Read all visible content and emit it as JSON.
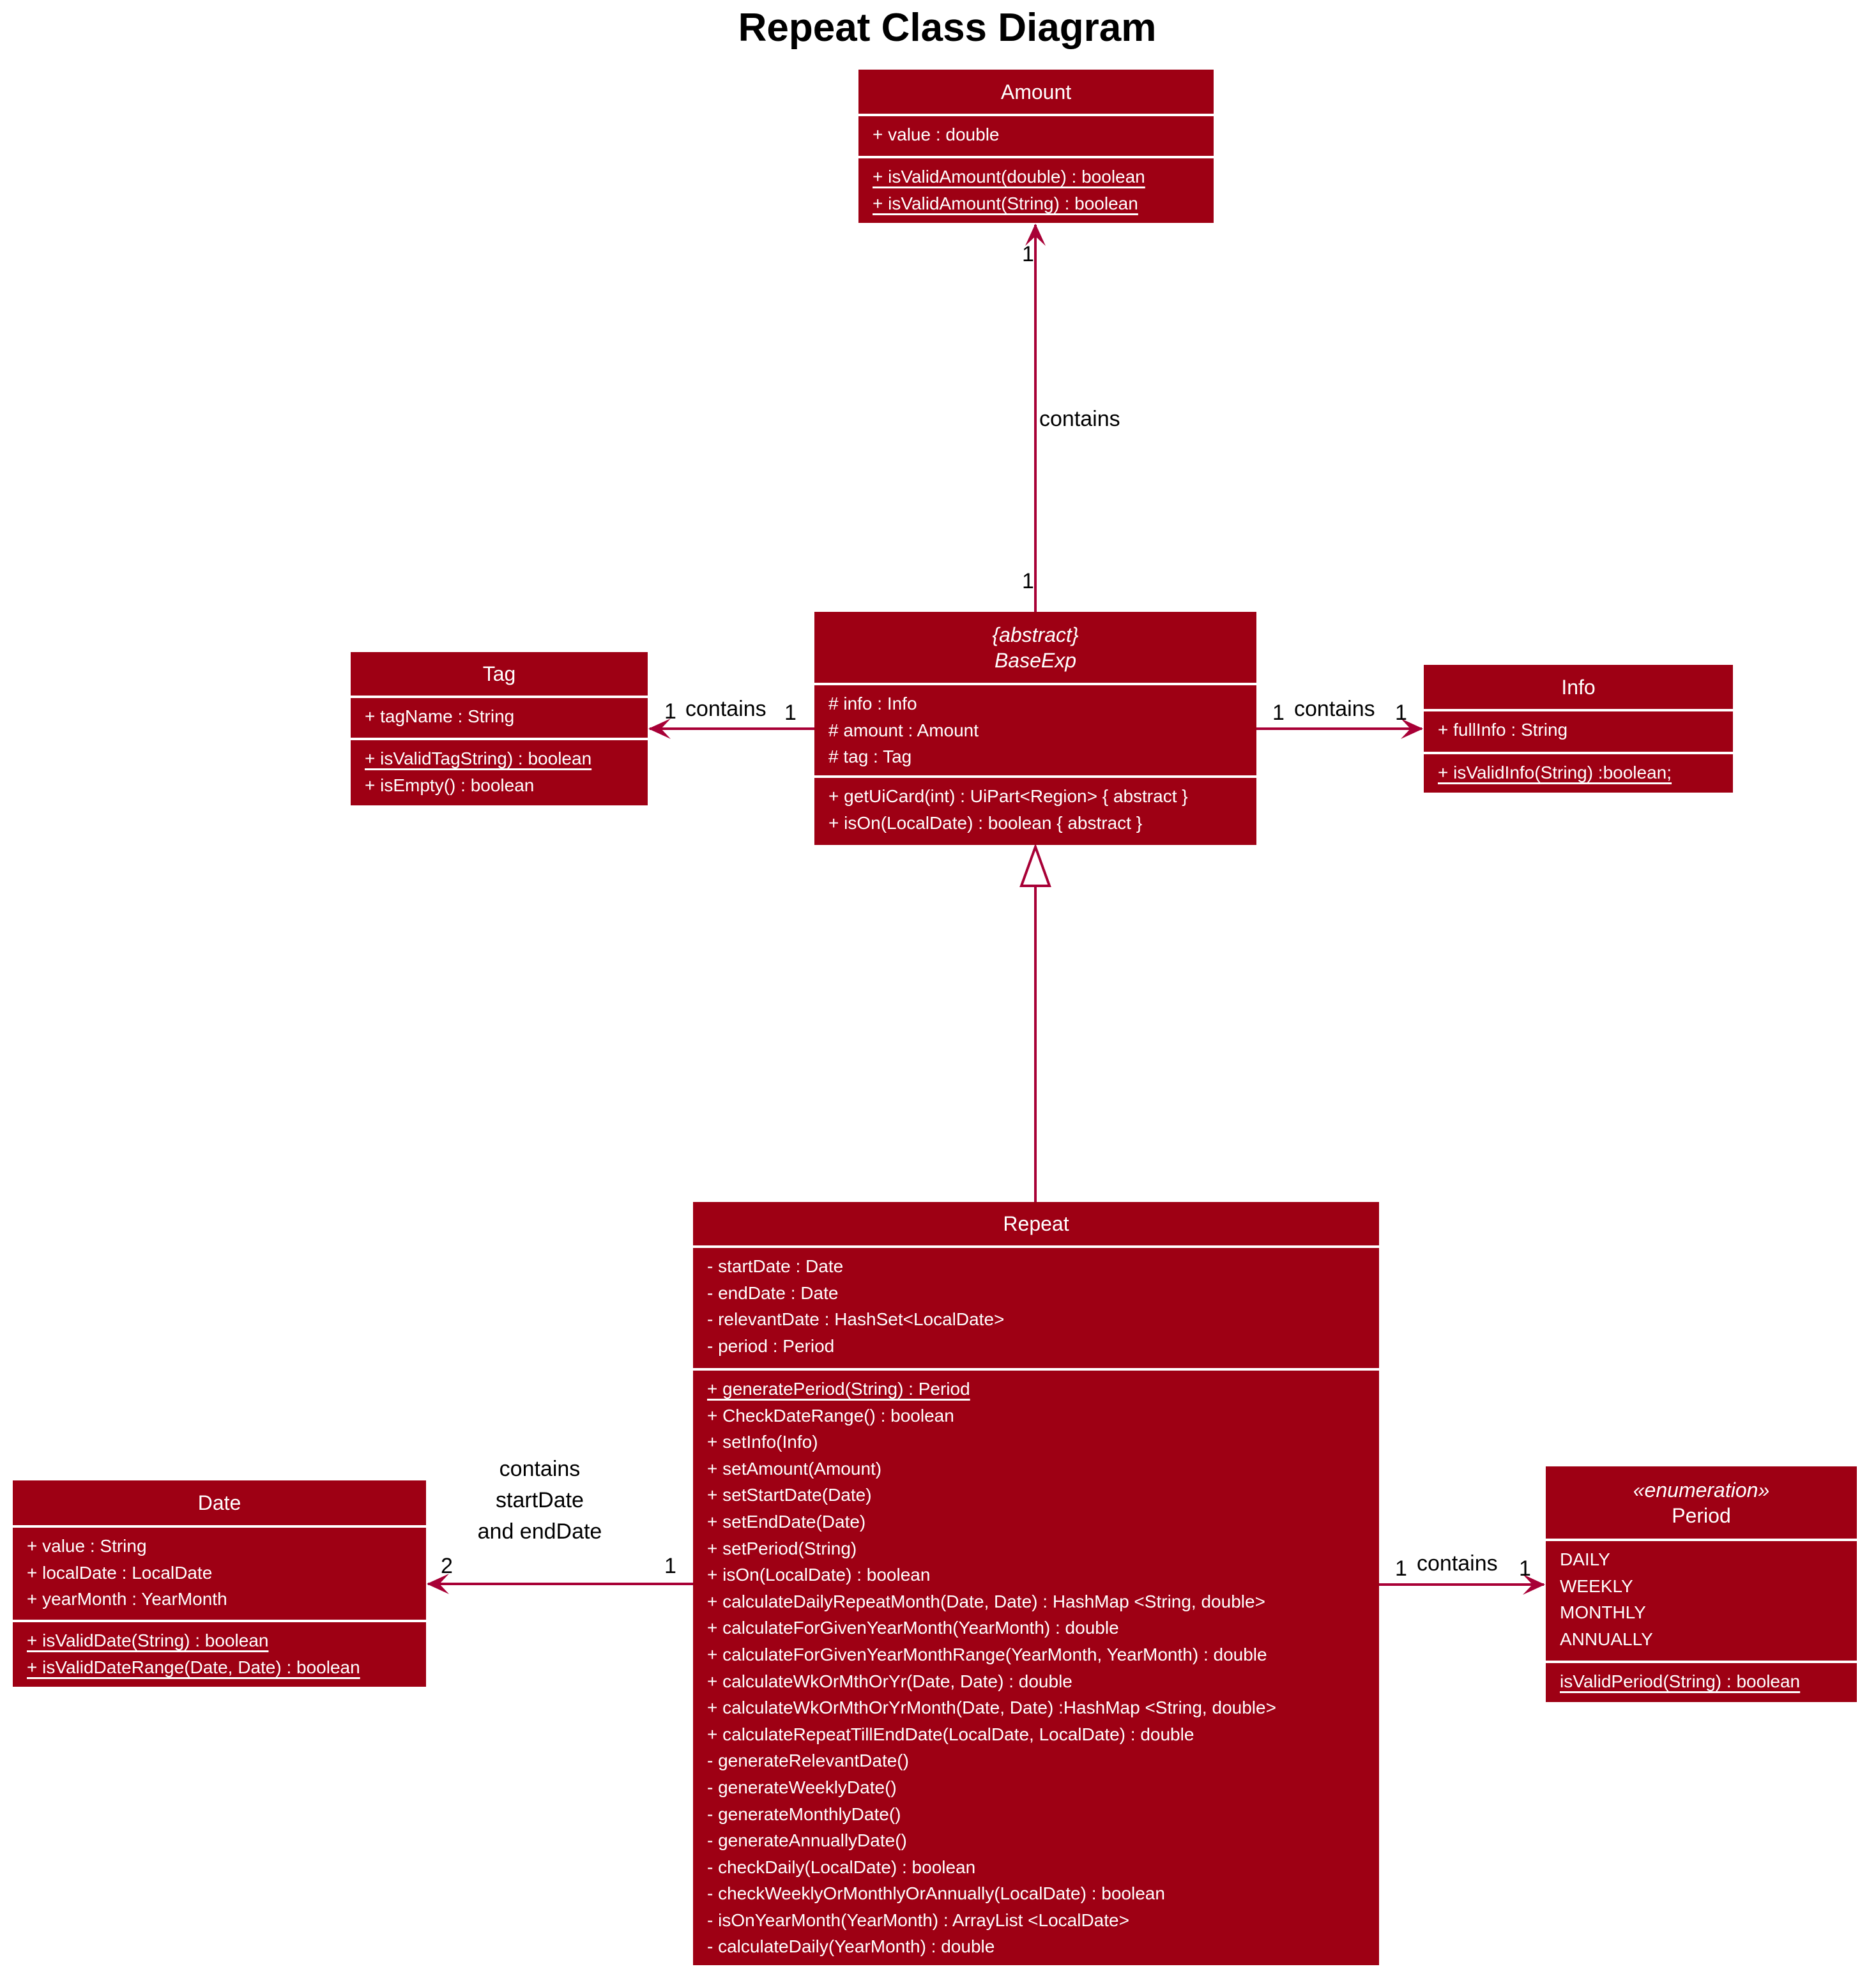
{
  "title": "Repeat Class Diagram",
  "colors": {
    "class_fill": "#9e0014",
    "line": "#a80036",
    "text_on_class": "#ffffff"
  },
  "classes": {
    "amount": {
      "name": "Amount",
      "attributes": [
        "+ value : double"
      ],
      "methods": [
        {
          "text": "+ isValidAmount(double) : boolean",
          "static": true
        },
        {
          "text": "+ isValidAmount(String) : boolean",
          "static": true
        }
      ]
    },
    "baseexp": {
      "stereotype": "{abstract}",
      "name": "BaseExp",
      "attributes": [
        "# info : Info",
        "# amount : Amount",
        "# tag : Tag"
      ],
      "methods": [
        {
          "text": "+ getUiCard(int) : UiPart<Region> { abstract }",
          "static": false
        },
        {
          "text": "+ isOn(LocalDate) : boolean { abstract }",
          "static": false
        }
      ]
    },
    "tag": {
      "name": "Tag",
      "attributes": [
        "+ tagName : String"
      ],
      "methods": [
        {
          "text": "+ isValidTagString) : boolean",
          "static": true
        },
        {
          "text": "+ isEmpty() : boolean",
          "static": false
        }
      ]
    },
    "info": {
      "name": "Info",
      "attributes": [
        "+ fullInfo : String"
      ],
      "methods": [
        {
          "text": " + isValidInfo(String) :boolean;",
          "static": true
        }
      ]
    },
    "repeat": {
      "name": "Repeat",
      "attributes": [
        "- startDate : Date",
        "- endDate : Date",
        "- relevantDate : HashSet<LocalDate>",
        "- period : Period"
      ],
      "methods": [
        {
          "text": "+ generatePeriod(String) : Period",
          "static": true
        },
        {
          "text": "+ CheckDateRange() : boolean",
          "static": false
        },
        {
          "text": "+ setInfo(Info)",
          "static": false
        },
        {
          "text": "+ setAmount(Amount)",
          "static": false
        },
        {
          "text": "+ setStartDate(Date)",
          "static": false
        },
        {
          "text": "+ setEndDate(Date)",
          "static": false
        },
        {
          "text": "+ setPeriod(String)",
          "static": false
        },
        {
          "text": "+ isOn(LocalDate) : boolean",
          "static": false
        },
        {
          "text": "+ calculateDailyRepeatMonth(Date, Date) : HashMap <String, double>",
          "static": false
        },
        {
          "text": "+ calculateForGivenYearMonth(YearMonth) : double",
          "static": false
        },
        {
          "text": "+ calculateForGivenYearMonthRange(YearMonth, YearMonth) : double",
          "static": false
        },
        {
          "text": "+ calculateWkOrMthOrYr(Date, Date) : double",
          "static": false
        },
        {
          "text": "+ calculateWkOrMthOrYrMonth(Date, Date) :HashMap <String, double>",
          "static": false
        },
        {
          "text": "+ calculateRepeatTillEndDate(LocalDate, LocalDate) : double",
          "static": false
        },
        {
          "text": "- generateRelevantDate()",
          "static": false
        },
        {
          "text": "- generateWeeklyDate()",
          "static": false
        },
        {
          "text": "- generateMonthlyDate()",
          "static": false
        },
        {
          "text": "- generateAnnuallyDate()",
          "static": false
        },
        {
          "text": "- checkDaily(LocalDate) : boolean",
          "static": false
        },
        {
          "text": "- checkWeeklyOrMonthlyOrAnnually(LocalDate) : boolean",
          "static": false
        },
        {
          "text": "- isOnYearMonth(YearMonth) : ArrayList <LocalDate>",
          "static": false
        },
        {
          "text": "- calculateDaily(YearMonth) : double",
          "static": false
        }
      ]
    },
    "date": {
      "name": "Date",
      "attributes": [
        "+ value : String",
        "+ localDate : LocalDate",
        "+ yearMonth : YearMonth"
      ],
      "methods": [
        {
          "text": "+ isValidDate(String) : boolean",
          "static": true
        },
        {
          "text": "+ isValidDateRange(Date, Date) : boolean",
          "static": true
        }
      ]
    },
    "period": {
      "stereotype": "«enumeration»",
      "name": "Period",
      "attributes": [
        "DAILY",
        "WEEKLY",
        "MONTHLY",
        "ANNUALLY"
      ],
      "methods": [
        {
          "text": "isValidPeriod(String) : boolean",
          "static": true
        }
      ]
    }
  },
  "relations": {
    "baseexp_amount": {
      "label": "contains",
      "source_mult": "1",
      "target_mult": "1"
    },
    "baseexp_tag": {
      "label": "contains",
      "source_mult": "1",
      "target_mult": "1"
    },
    "baseexp_info": {
      "label": "contains",
      "source_mult": "1",
      "target_mult": "1"
    },
    "repeat_date": {
      "label_lines": [
        "contains",
        "startDate",
        "and endDate"
      ],
      "source_mult": "1",
      "target_mult": "2"
    },
    "repeat_period": {
      "label": "contains",
      "source_mult": "1",
      "target_mult": "1"
    },
    "repeat_baseexp": {
      "type": "generalization"
    }
  }
}
